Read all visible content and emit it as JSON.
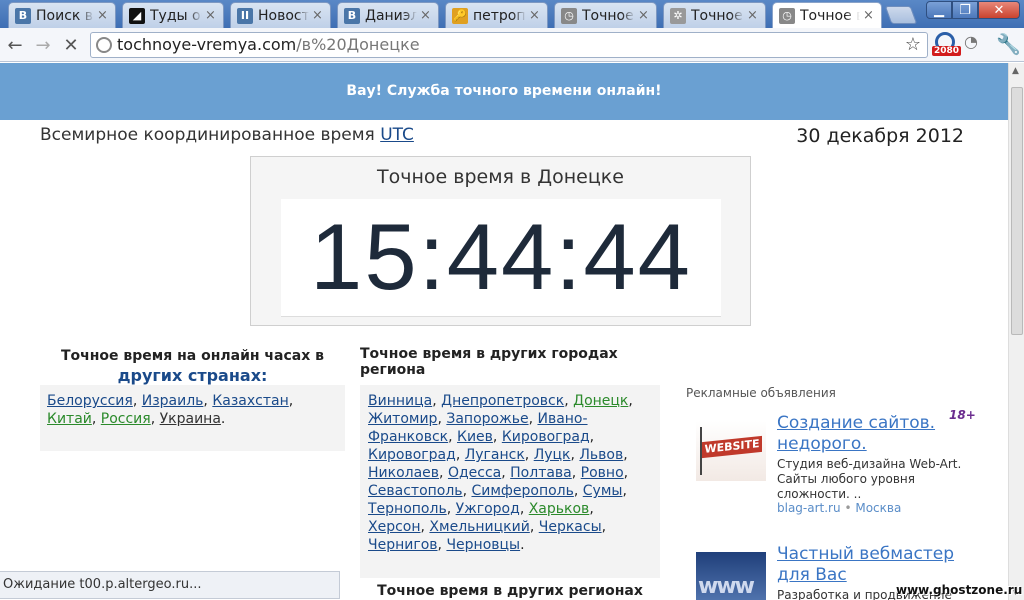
{
  "browser": {
    "tabs": [
      {
        "title": "Поиск в",
        "icon": "vk-icon",
        "color": "#4a76a8",
        "glyph": "B"
      },
      {
        "title": "Туды о0",
        "icon": "app-icon",
        "color": "#111111",
        "glyph": "◢"
      },
      {
        "title": "Новости",
        "icon": "pause-icon",
        "color": "#4a76a8",
        "glyph": "II"
      },
      {
        "title": "Даниэла",
        "icon": "vk-icon",
        "color": "#4a76a8",
        "glyph": "B"
      },
      {
        "title": "петропа",
        "icon": "search-icon",
        "color": "#e0a020",
        "glyph": "🔑"
      },
      {
        "title": "Точное в",
        "icon": "clock-icon",
        "color": "#888888",
        "glyph": "◷"
      },
      {
        "title": "Точное в",
        "icon": "clock-icon",
        "color": "#999999",
        "glyph": "✲"
      },
      {
        "title": "Точное в",
        "icon": "clock-icon",
        "color": "#888888",
        "glyph": "◷",
        "active": true
      }
    ],
    "tab_close": "×",
    "url_host": "tochnoye-vremya.com",
    "url_path": "/в%20Донецке",
    "badge": "2080"
  },
  "page": {
    "banner": "Вау! Служба точного времени онлайн!",
    "utc_prefix": "Всемирное координированное время",
    "utc_link": "UTC",
    "date": "30 декабря 2012",
    "clock_title": "Точное время в Донецке",
    "clock_time": "15:44:44",
    "countries_title": "Точное время на онлайн часах в",
    "countries_title_link": "других странах:",
    "countries": [
      {
        "name": "Белоруссия",
        "style": "link"
      },
      {
        "name": "Израиль",
        "style": "link"
      },
      {
        "name": "Казахстан",
        "style": "link"
      },
      {
        "name": "Китай",
        "style": "green"
      },
      {
        "name": "Россия",
        "style": "green"
      },
      {
        "name": "Украина",
        "style": "dark"
      }
    ],
    "cities_title": "Точное время в других городах региона",
    "cities": [
      {
        "name": "Винница",
        "style": "link"
      },
      {
        "name": "Днепропетровск",
        "style": "link"
      },
      {
        "name": "Донецк",
        "style": "green"
      },
      {
        "name": "Житомир",
        "style": "link"
      },
      {
        "name": "Запорожье",
        "style": "link"
      },
      {
        "name": "Ивано-Франковск",
        "style": "link"
      },
      {
        "name": "Киев",
        "style": "link"
      },
      {
        "name": "Кировоград",
        "style": "link"
      },
      {
        "name": "Кировоград",
        "style": "link"
      },
      {
        "name": "Луганск",
        "style": "link"
      },
      {
        "name": "Луцк",
        "style": "link"
      },
      {
        "name": "Львов",
        "style": "link"
      },
      {
        "name": "Николаев",
        "style": "link"
      },
      {
        "name": "Одесса",
        "style": "link"
      },
      {
        "name": "Полтава",
        "style": "link"
      },
      {
        "name": "Ровно",
        "style": "link"
      },
      {
        "name": "Севастополь",
        "style": "link"
      },
      {
        "name": "Симферополь",
        "style": "link"
      },
      {
        "name": "Сумы",
        "style": "link"
      },
      {
        "name": "Тернополь",
        "style": "link"
      },
      {
        "name": "Ужгород",
        "style": "link"
      },
      {
        "name": "Харьков",
        "style": "green"
      },
      {
        "name": "Херсон",
        "style": "link"
      },
      {
        "name": "Хмельницкий",
        "style": "link"
      },
      {
        "name": "Черкасы",
        "style": "link"
      },
      {
        "name": "Чернигов",
        "style": "link"
      },
      {
        "name": "Черновцы",
        "style": "link"
      }
    ],
    "regions_title": "Точное время в других регионах",
    "ads_label": "Рекламные объявления",
    "ad_age": "18+",
    "ads": [
      {
        "title": "Создание сайтов. недорого.",
        "text": "Студия веб-дизайна Web-Art. Сайты любого уровня сложности. ..",
        "source": "blag-art.ru",
        "region": "Москва",
        "image_text": "WEBSITE"
      },
      {
        "title": "Частный вебмастер для Вас",
        "text": "Разработка и продвижение",
        "source": "",
        "region": "",
        "image_text": "www"
      }
    ]
  },
  "status_text": "Ожидание t00.p.altergeo.ru...",
  "watermark": "www.ghostzone.ru"
}
